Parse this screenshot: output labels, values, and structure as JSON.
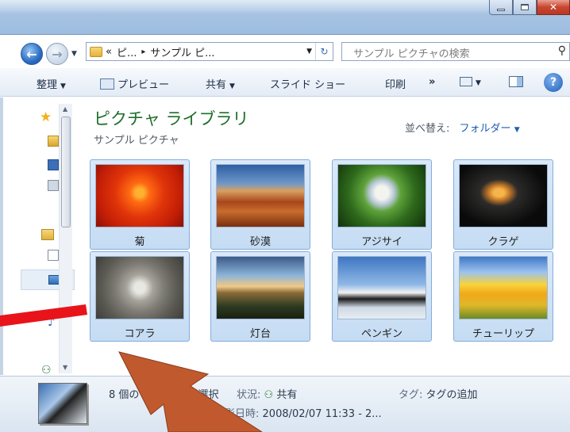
{
  "window": {
    "minimize_icon": "minimize-icon",
    "maximize_icon": "maximize-icon",
    "close_icon": "close-icon"
  },
  "navigation": {
    "back_icon": "back-arrow-icon",
    "forward_icon": "forward-arrow-icon",
    "address": {
      "overflow": "«",
      "crumb_1": "ピ...",
      "separator": "▸",
      "crumb_2": "サンプル ピ..."
    },
    "search_placeholder": "サンプル ピクチャの検索"
  },
  "toolbar": {
    "organize": "整理",
    "preview": "プレビュー",
    "share": "共有",
    "slideshow": "スライド ショー",
    "print": "印刷",
    "more": "»"
  },
  "library": {
    "title": "ピクチャ ライブラリ",
    "subtitle": "サンプル ピクチャ",
    "arrange_label": "並べ替え:",
    "arrange_value": "フォルダー"
  },
  "files": [
    {
      "name": "菊",
      "icon": "chrysanthemum-thumbnail"
    },
    {
      "name": "砂漠",
      "icon": "desert-thumbnail"
    },
    {
      "name": "アジサイ",
      "icon": "hydrangeas-thumbnail"
    },
    {
      "name": "クラゲ",
      "icon": "jellyfish-thumbnail"
    },
    {
      "name": "コアラ",
      "icon": "koala-thumbnail"
    },
    {
      "name": "灯台",
      "icon": "lighthouse-thumbnail"
    },
    {
      "name": "ペンギン",
      "icon": "penguins-thumbnail"
    },
    {
      "name": "チューリップ",
      "icon": "tulips-thumbnail"
    }
  ],
  "details": {
    "count_text": "8 個の",
    "count_suffix": "選択",
    "status_label": "状況:",
    "status_value": "共有",
    "tags_label": "タグ:",
    "tags_value": "タグの追加",
    "date_label": "撮影日時:",
    "date_value": "2008/02/07 11:33 - 2..."
  },
  "colors": {
    "library_title": "#1e6f2a",
    "link_blue": "#1d5fb3",
    "tile_selected": "#c5dcf3",
    "annotation_red": "#e8141a",
    "annotation_arrow": "#c05a2e"
  }
}
